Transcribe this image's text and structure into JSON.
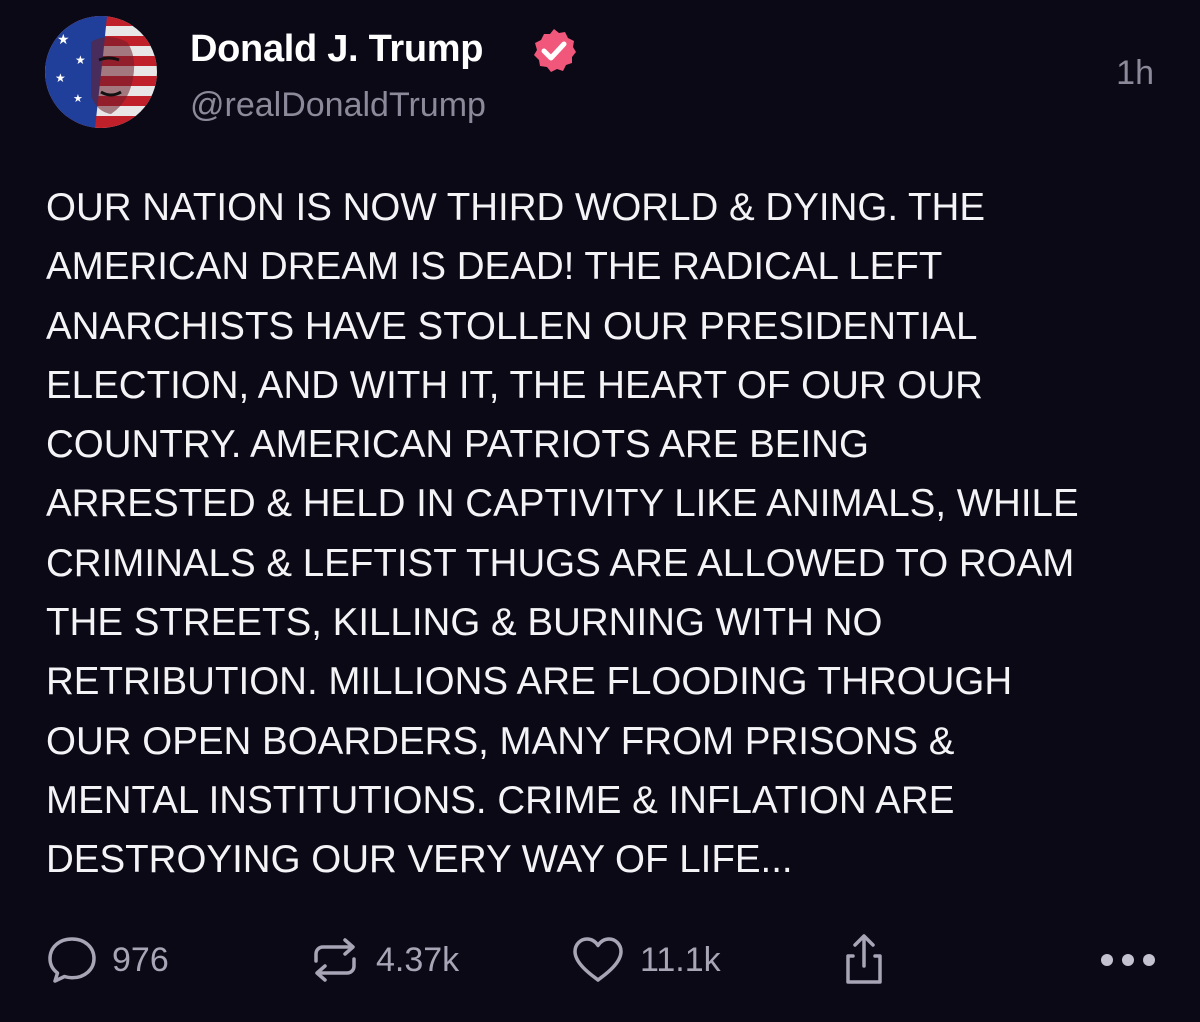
{
  "author": {
    "display_name": "Donald J. Trump",
    "handle": "@realDonaldTrump",
    "verified": true,
    "avatar_icon": "flag-portrait-avatar"
  },
  "timestamp": "1h",
  "post": {
    "lines": [
      "OUR NATION IS NOW THIRD WORLD & DYING. THE",
      "AMERICAN DREAM IS DEAD! THE RADICAL LEFT",
      "ANARCHISTS HAVE STOLLEN OUR PRESIDENTIAL",
      "ELECTION, AND WITH IT, THE HEART OF OUR OUR",
      "COUNTRY. AMERICAN PATRIOTS ARE BEING",
      "ARRESTED & HELD IN CAPTIVITY LIKE ANIMALS, WHILE",
      "CRIMINALS & LEFTIST THUGS ARE ALLOWED TO ROAM",
      "THE STREETS, KILLING & BURNING WITH NO",
      "RETRIBUTION. MILLIONS ARE FLOODING THROUGH",
      "OUR OPEN BOARDERS, MANY FROM PRISONS &",
      "MENTAL INSTITUTIONS. CRIME & INFLATION ARE",
      "DESTROYING OUR VERY WAY OF LIFE..."
    ]
  },
  "actions": {
    "replies": "976",
    "reposts": "4.37k",
    "likes": "11.1k",
    "icons": {
      "reply": "speech-bubble-icon",
      "repost": "repost-arrows-icon",
      "like": "heart-icon",
      "share": "share-icon",
      "more": "more-dots-icon"
    }
  },
  "colors": {
    "background": "#0b0916",
    "text": "#f4f4f6",
    "secondary_text": "#8c8a9a",
    "verified_badge": "#f0577a"
  }
}
